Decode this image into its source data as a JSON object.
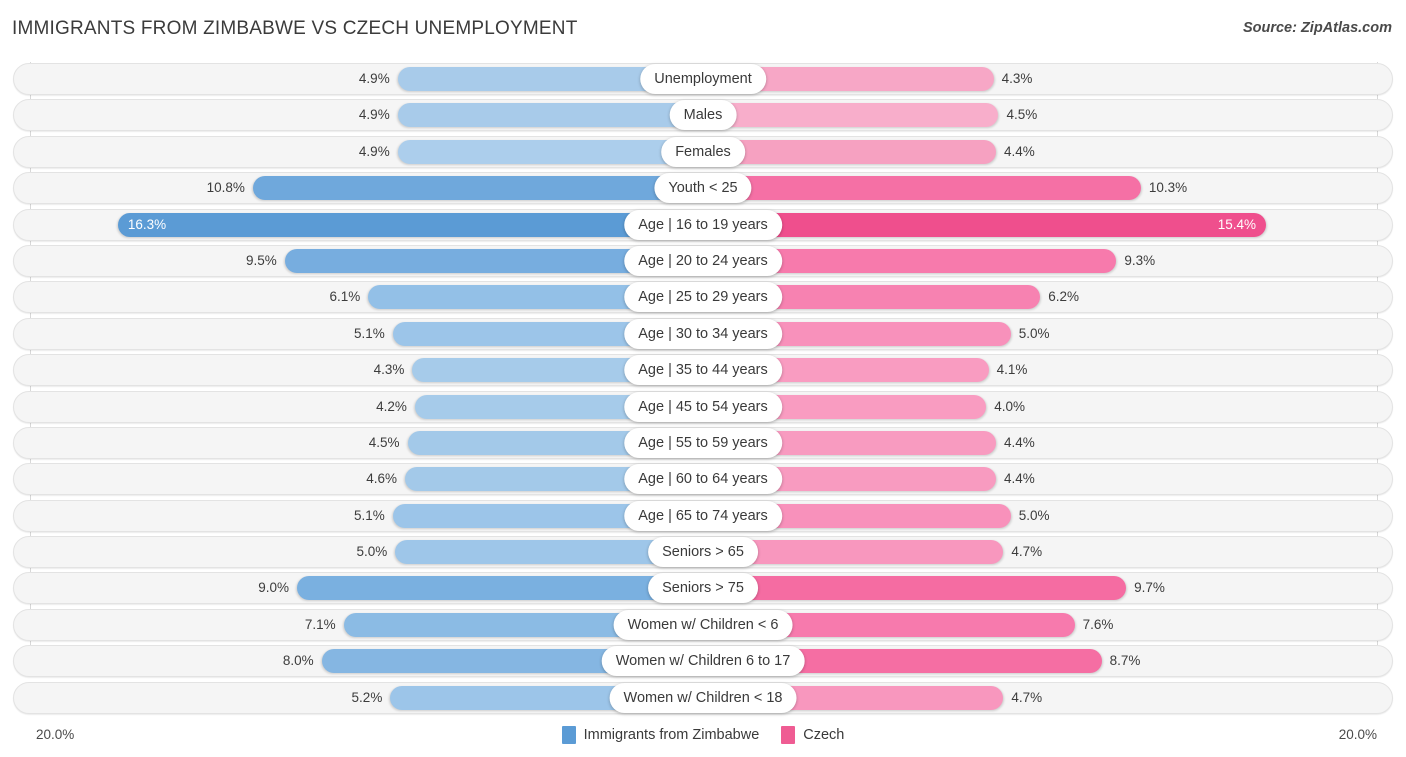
{
  "header": {
    "title": "IMMIGRANTS FROM ZIMBABWE VS CZECH UNEMPLOYMENT",
    "source": "Source: ZipAtlas.com"
  },
  "axis": {
    "left_label": "20.0%",
    "right_label": "20.0%"
  },
  "legend": {
    "items": [
      {
        "label": "Immigrants from Zimbabwe",
        "color": "#5b9bd5"
      },
      {
        "label": "Czech",
        "color": "#ef5c93"
      }
    ]
  },
  "chart_data": {
    "type": "bar",
    "subtype": "diverging-bidirectional",
    "title": "IMMIGRANTS FROM ZIMBABWE VS CZECH UNEMPLOYMENT",
    "xlabel": "",
    "ylabel": "",
    "xlim": [
      20.0,
      20.0
    ],
    "axis_max_percent": 20.0,
    "grid": true,
    "legend_position": "bottom-center",
    "categories": [
      "Unemployment",
      "Males",
      "Females",
      "Youth < 25",
      "Age | 16 to 19 years",
      "Age | 20 to 24 years",
      "Age | 25 to 29 years",
      "Age | 30 to 34 years",
      "Age | 35 to 44 years",
      "Age | 45 to 54 years",
      "Age | 55 to 59 years",
      "Age | 60 to 64 years",
      "Age | 65 to 74 years",
      "Seniors > 65",
      "Seniors > 75",
      "Women w/ Children < 6",
      "Women w/ Children 6 to 17",
      "Women w/ Children < 18"
    ],
    "series": [
      {
        "name": "Immigrants from Zimbabwe",
        "side": "left",
        "color": "#5b9bd5",
        "values": [
          4.9,
          4.9,
          4.9,
          10.8,
          16.3,
          9.5,
          6.1,
          5.1,
          4.3,
          4.2,
          4.5,
          4.6,
          5.1,
          5.0,
          9.0,
          7.1,
          8.0,
          5.2
        ],
        "labels": [
          "4.9%",
          "4.9%",
          "4.9%",
          "10.8%",
          "16.3%",
          "9.5%",
          "6.1%",
          "5.1%",
          "4.3%",
          "4.2%",
          "4.5%",
          "4.6%",
          "5.1%",
          "5.0%",
          "9.0%",
          "7.1%",
          "8.0%",
          "5.2%"
        ]
      },
      {
        "name": "Czech",
        "side": "right",
        "color": "#ef5c93",
        "values": [
          4.3,
          4.5,
          4.4,
          10.3,
          15.4,
          9.3,
          6.2,
          5.0,
          4.1,
          4.0,
          4.4,
          4.4,
          5.0,
          4.7,
          9.7,
          7.6,
          8.7,
          4.7
        ],
        "labels": [
          "4.3%",
          "4.5%",
          "4.4%",
          "10.3%",
          "15.4%",
          "9.3%",
          "6.2%",
          "5.0%",
          "4.1%",
          "4.0%",
          "4.4%",
          "4.4%",
          "5.0%",
          "4.7%",
          "9.7%",
          "7.6%",
          "8.7%",
          "4.7%"
        ]
      }
    ]
  },
  "rows": [
    {
      "label": "Unemployment",
      "left_value": 4.9,
      "left_label": "4.9%",
      "right_value": 4.3,
      "right_label": "4.3%",
      "left_color": "#a8cbea",
      "right_color": "#f7a7c6",
      "emphasis": false
    },
    {
      "label": "Males",
      "left_value": 4.9,
      "left_label": "4.9%",
      "right_value": 4.5,
      "right_label": "4.5%",
      "left_color": "#a8cbea",
      "right_color": "#f8aecb",
      "emphasis": false
    },
    {
      "label": "Females",
      "left_value": 4.9,
      "left_label": "4.9%",
      "right_value": 4.4,
      "right_label": "4.4%",
      "left_color": "#acceec",
      "right_color": "#f6a1c1",
      "emphasis": false
    },
    {
      "label": "Youth < 25",
      "left_value": 10.8,
      "left_label": "10.8%",
      "right_value": 10.3,
      "right_label": "10.3%",
      "left_color": "#6fa8dc",
      "right_color": "#f570a5",
      "emphasis": false
    },
    {
      "label": "Age | 16 to 19 years",
      "left_value": 16.3,
      "left_label": "16.3%",
      "right_value": 15.4,
      "right_label": "15.4%",
      "left_color": "#5b9bd5",
      "right_color": "#ef4f8d",
      "emphasis": true
    },
    {
      "label": "Age | 20 to 24 years",
      "left_value": 9.5,
      "left_label": "9.5%",
      "right_value": 9.3,
      "right_label": "9.3%",
      "left_color": "#77addf",
      "right_color": "#f77aac",
      "emphasis": false
    },
    {
      "label": "Age | 25 to 29 years",
      "left_value": 6.1,
      "left_label": "6.1%",
      "right_value": 6.2,
      "right_label": "6.2%",
      "left_color": "#93c0e7",
      "right_color": "#f782b1",
      "emphasis": false
    },
    {
      "label": "Age | 30 to 34 years",
      "left_value": 5.1,
      "left_label": "5.1%",
      "right_value": 5.0,
      "right_label": "5.0%",
      "left_color": "#9cc5e9",
      "right_color": "#f891bb",
      "emphasis": false
    },
    {
      "label": "Age | 35 to 44 years",
      "left_value": 4.3,
      "left_label": "4.3%",
      "right_value": 4.1,
      "right_label": "4.1%",
      "left_color": "#a6cbea",
      "right_color": "#f99cc1",
      "emphasis": false
    },
    {
      "label": "Age | 45 to 54 years",
      "left_value": 4.2,
      "left_label": "4.2%",
      "right_value": 4.0,
      "right_label": "4.0%",
      "left_color": "#a6cbea",
      "right_color": "#f99cc1",
      "emphasis": false
    },
    {
      "label": "Age | 55 to 59 years",
      "left_value": 4.5,
      "left_label": "4.5%",
      "right_value": 4.4,
      "right_label": "4.4%",
      "left_color": "#a3c9e9",
      "right_color": "#f89bc0",
      "emphasis": false
    },
    {
      "label": "Age | 60 to 64 years",
      "left_value": 4.6,
      "left_label": "4.6%",
      "right_value": 4.4,
      "right_label": "4.4%",
      "left_color": "#a3c9e9",
      "right_color": "#f89bc0",
      "emphasis": false
    },
    {
      "label": "Age | 65 to 74 years",
      "left_value": 5.1,
      "left_label": "5.1%",
      "right_value": 5.0,
      "right_label": "5.0%",
      "left_color": "#9cc5e9",
      "right_color": "#f891bb",
      "emphasis": false
    },
    {
      "label": "Seniors > 65",
      "left_value": 5.0,
      "left_label": "5.0%",
      "right_value": 4.7,
      "right_label": "4.7%",
      "left_color": "#9ec6e9",
      "right_color": "#f897be",
      "emphasis": false
    },
    {
      "label": "Seniors > 75",
      "left_value": 9.0,
      "left_label": "9.0%",
      "right_value": 9.7,
      "right_label": "9.7%",
      "left_color": "#7ab0e0",
      "right_color": "#f56ca2",
      "emphasis": false
    },
    {
      "label": "Women w/ Children < 6",
      "left_value": 7.1,
      "left_label": "7.1%",
      "right_value": 7.6,
      "right_label": "7.6%",
      "left_color": "#8bbbe4",
      "right_color": "#f77aad",
      "emphasis": false
    },
    {
      "label": "Women w/ Children 6 to 17",
      "left_value": 8.0,
      "left_label": "8.0%",
      "right_value": 8.7,
      "right_label": "8.7%",
      "left_color": "#85b6e2",
      "right_color": "#f56ea3",
      "emphasis": false
    },
    {
      "label": "Women w/ Children < 18",
      "left_value": 5.2,
      "left_label": "5.2%",
      "right_value": 4.7,
      "right_label": "4.7%",
      "left_color": "#9cc5e9",
      "right_color": "#f897be",
      "emphasis": false
    }
  ]
}
